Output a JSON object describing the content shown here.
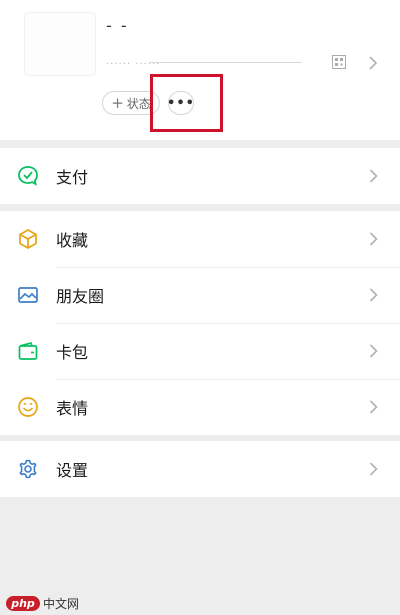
{
  "profile": {
    "name": "- -",
    "wechat_id_label": "...... ......",
    "status_button_label": "状态",
    "status_plus": "+",
    "more_button_label": "•••"
  },
  "menu": {
    "pay": {
      "label": "支付",
      "icon": "wechat-pay-icon"
    },
    "favorites": {
      "label": "收藏",
      "icon": "cube-icon"
    },
    "moments": {
      "label": "朋友圈",
      "icon": "image-icon"
    },
    "cards": {
      "label": "卡包",
      "icon": "wallet-icon"
    },
    "stickers": {
      "label": "表情",
      "icon": "smiley-icon"
    },
    "settings": {
      "label": "设置",
      "icon": "gear-icon"
    }
  },
  "watermark": {
    "logo": "php",
    "text": "中文网"
  },
  "colors": {
    "background": "#ededed",
    "highlight": "#d0112b",
    "icon_green": "#07c160",
    "icon_blue": "#3f7ec7",
    "icon_gold": "#e8a317"
  }
}
